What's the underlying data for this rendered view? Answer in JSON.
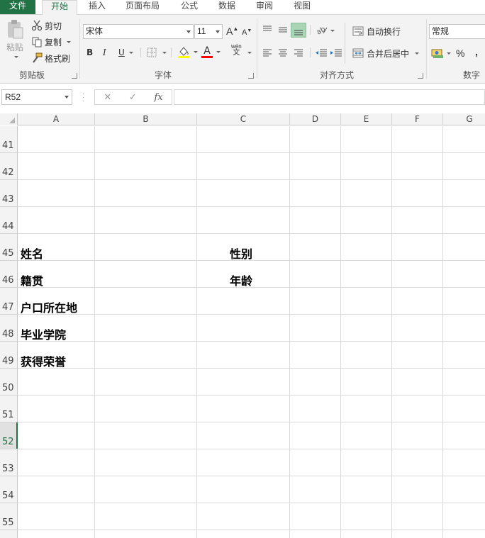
{
  "tabs": {
    "file": "文件",
    "home": "开始",
    "insert": "插入",
    "layout": "页面布局",
    "formulas": "公式",
    "data": "数据",
    "review": "审阅",
    "view": "视图"
  },
  "clipboard": {
    "paste": "粘贴",
    "cut": "剪切",
    "copy": "复制",
    "format_painter": "格式刷",
    "label": "剪贴板"
  },
  "font": {
    "name": "宋体",
    "size": "11",
    "bold": "B",
    "italic": "I",
    "underline": "U",
    "grow": "A",
    "shrink": "A",
    "color_glyph": "A",
    "phonetic": "wén",
    "phonetic_sub": "文",
    "label": "字体",
    "fill_color": "#ffff00",
    "font_color": "#ff0000"
  },
  "alignment": {
    "wrap_text": "自动换行",
    "merge_center": "合并后居中",
    "label": "对齐方式"
  },
  "number": {
    "format": "常规",
    "percent": "%",
    "comma": ",",
    "label": "数字"
  },
  "formula_bar": {
    "name_box": "R52",
    "cancel": "✕",
    "enter": "✓",
    "fx": "fx",
    "value": ""
  },
  "columns": [
    "A",
    "B",
    "C",
    "D",
    "E",
    "F",
    "G"
  ],
  "rows": [
    "41",
    "42",
    "43",
    "44",
    "45",
    "46",
    "47",
    "48",
    "49",
    "50",
    "51",
    "52",
    "53",
    "54",
    "55"
  ],
  "selected_row": "52",
  "cells": {
    "a45": "姓名",
    "c45": "性别",
    "a46": "籍贯",
    "c46": "年龄",
    "a47": "户口所在地",
    "a48": "毕业学院",
    "a49": "获得荣誉"
  },
  "colors": {
    "accent": "#217346",
    "ribbon_bg": "#f3f3f3",
    "gridline": "#dadada"
  }
}
